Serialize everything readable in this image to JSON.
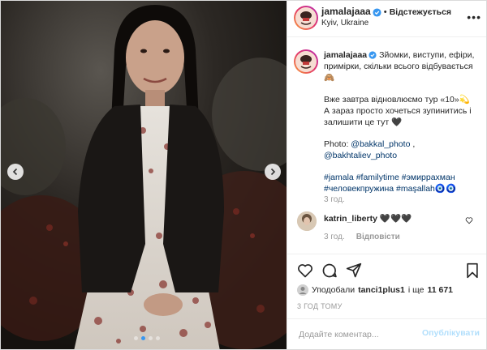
{
  "header": {
    "username": "jamalajaaa",
    "separator": "•",
    "follow_label": "Відстежується",
    "location": "Kyiv, Ukraine",
    "more_label": "•••"
  },
  "caption": {
    "username": "jamalajaaa",
    "line1": "Зйомки, виступи, ефіри, примірки, скільки всього відбувається 🙈",
    "line2": "Вже завтра відновлюємо тур «10»💫\nА зараз просто хочеться зупинитись і залишити це тут 🖤",
    "photo_prefix": "Photo:",
    "photo_handle_1": "@bakkal_photo",
    "photo_sep": ",",
    "photo_handle_2": "@bakhtaliev_photo",
    "hashtag_1": "#jamala",
    "hashtag_2": "#familytime",
    "hashtag_3": "#эмиррахман",
    "hashtag_4": "#человекпружина",
    "hashtag_5": "#maşallah",
    "hashtag_emoji": "🧿🧿",
    "time": "3 год."
  },
  "comment": {
    "username": "katrin_liberty",
    "text": "🖤🖤🖤",
    "time": "3 год.",
    "reply_label": "Відповісти"
  },
  "likes": {
    "prefix": "Уподобали",
    "user": "tanci1plus1",
    "connector": "і ще",
    "count": "11 671"
  },
  "post_time": "3 ГОД ТОМУ",
  "add_comment": {
    "placeholder": "Додайте коментар...",
    "publish_label": "Опублікувати"
  },
  "colors": {
    "link": "#003569",
    "verified": "#3897f0",
    "publish_disabled": "#b2dffc",
    "muted": "#999999"
  }
}
